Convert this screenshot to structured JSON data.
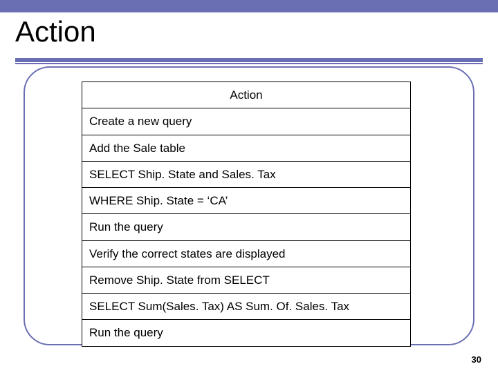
{
  "slide": {
    "title": "Action",
    "page_number": "30"
  },
  "table": {
    "header": "Action",
    "rows": [
      "Create a new query",
      "Add the Sale table",
      "SELECT Ship. State and Sales. Tax",
      "WHERE Ship. State = ‘CA’",
      "Run the query",
      "Verify the correct states are displayed",
      "Remove Ship. State from SELECT",
      "SELECT Sum(Sales. Tax) AS Sum. Of. Sales. Tax",
      "Run the query"
    ]
  }
}
